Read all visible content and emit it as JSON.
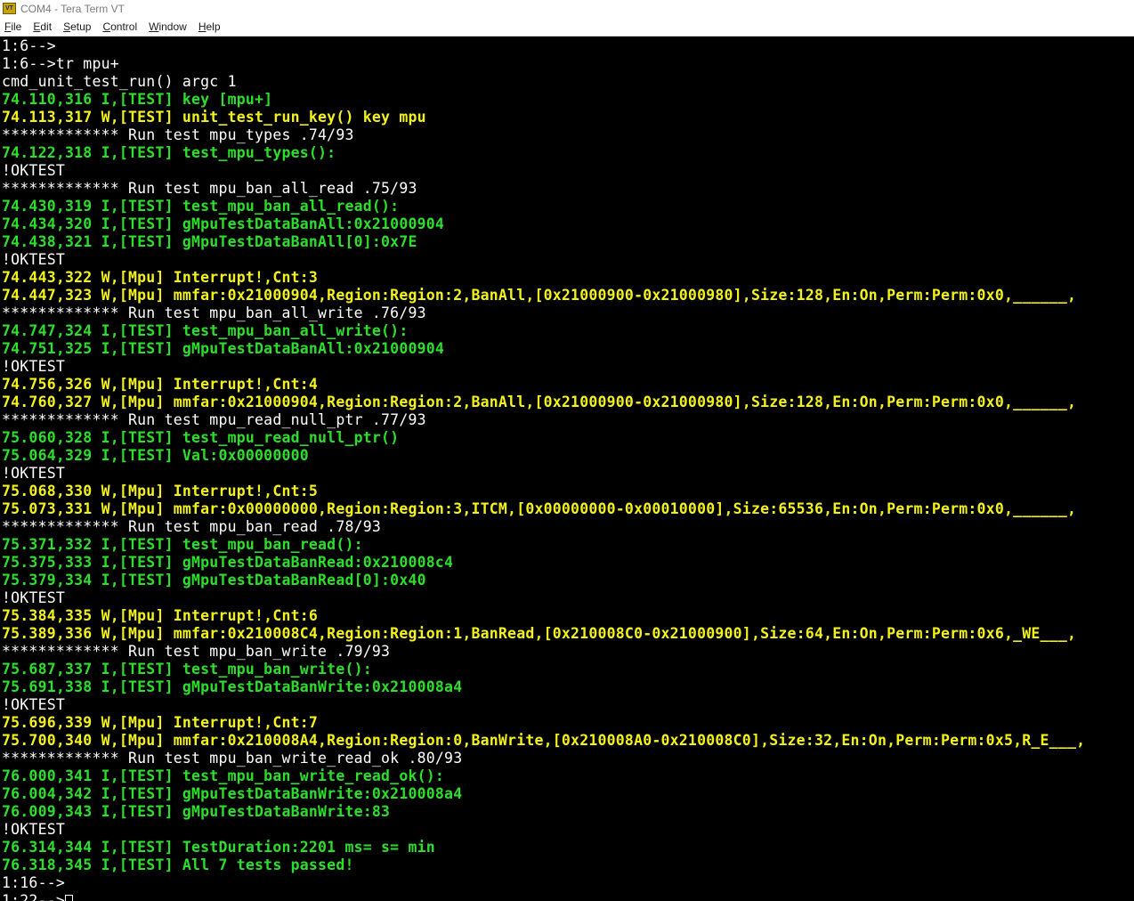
{
  "window": {
    "title": "COM4 - Tera Term VT",
    "icon": "teraterm-app-icon",
    "icon_text": "VT"
  },
  "menu": [
    {
      "underline": "F",
      "rest": "ile",
      "label": "File"
    },
    {
      "underline": "E",
      "rest": "dit",
      "label": "Edit"
    },
    {
      "underline": "S",
      "rest": "etup",
      "label": "Setup"
    },
    {
      "underline": "C",
      "rest": "ontrol",
      "label": "Control"
    },
    {
      "underline": "W",
      "rest": "indow",
      "label": "Window"
    },
    {
      "underline": "H",
      "rest": "elp",
      "label": "Help"
    }
  ],
  "colors": {
    "background": "#000000",
    "normal": "#ffffff",
    "info": "#2bdf2b",
    "warning": "#f2f218"
  },
  "terminal": {
    "lines": [
      {
        "c": "white",
        "t": "1:6-->"
      },
      {
        "c": "white",
        "t": "1:6-->tr mpu+"
      },
      {
        "c": "white",
        "t": "cmd_unit_test_run() argc 1"
      },
      {
        "c": "green",
        "t": "74.110,316 I,[TEST] key [mpu+]"
      },
      {
        "c": "yellow",
        "t": "74.113,317 W,[TEST] unit_test_run_key() key mpu"
      },
      {
        "c": "white",
        "t": "************* Run test mpu_types .74/93"
      },
      {
        "c": "green",
        "t": "74.122,318 I,[TEST] test_mpu_types():"
      },
      {
        "c": "white",
        "t": "!OKTEST"
      },
      {
        "c": "white",
        "t": "************* Run test mpu_ban_all_read .75/93"
      },
      {
        "c": "green",
        "t": "74.430,319 I,[TEST] test_mpu_ban_all_read():"
      },
      {
        "c": "green",
        "t": "74.434,320 I,[TEST] gMpuTestDataBanAll:0x21000904"
      },
      {
        "c": "green",
        "t": "74.438,321 I,[TEST] gMpuTestDataBanAll[0]:0x7E"
      },
      {
        "c": "white",
        "t": "!OKTEST"
      },
      {
        "c": "yellow",
        "t": "74.443,322 W,[Mpu] Interrupt!,Cnt:3"
      },
      {
        "c": "yellow",
        "t": "74.447,323 W,[Mpu] mmfar:0x21000904,Region:Region:2,BanAll,[0x21000900-0x21000980],Size:128,En:On,Perm:Perm:0x0,______,"
      },
      {
        "c": "white",
        "t": "************* Run test mpu_ban_all_write .76/93"
      },
      {
        "c": "green",
        "t": "74.747,324 I,[TEST] test_mpu_ban_all_write():"
      },
      {
        "c": "green",
        "t": "74.751,325 I,[TEST] gMpuTestDataBanAll:0x21000904"
      },
      {
        "c": "white",
        "t": "!OKTEST"
      },
      {
        "c": "yellow",
        "t": "74.756,326 W,[Mpu] Interrupt!,Cnt:4"
      },
      {
        "c": "yellow",
        "t": "74.760,327 W,[Mpu] mmfar:0x21000904,Region:Region:2,BanAll,[0x21000900-0x21000980],Size:128,En:On,Perm:Perm:0x0,______,"
      },
      {
        "c": "white",
        "t": "************* Run test mpu_read_null_ptr .77/93"
      },
      {
        "c": "green",
        "t": "75.060,328 I,[TEST] test_mpu_read_null_ptr()"
      },
      {
        "c": "green",
        "t": "75.064,329 I,[TEST] Val:0x00000000"
      },
      {
        "c": "white",
        "t": "!OKTEST"
      },
      {
        "c": "yellow",
        "t": "75.068,330 W,[Mpu] Interrupt!,Cnt:5"
      },
      {
        "c": "yellow",
        "t": "75.073,331 W,[Mpu] mmfar:0x00000000,Region:Region:3,ITCM,[0x00000000-0x00010000],Size:65536,En:On,Perm:Perm:0x0,______,"
      },
      {
        "c": "white",
        "t": "************* Run test mpu_ban_read .78/93"
      },
      {
        "c": "green",
        "t": "75.371,332 I,[TEST] test_mpu_ban_read():"
      },
      {
        "c": "green",
        "t": "75.375,333 I,[TEST] gMpuTestDataBanRead:0x210008c4"
      },
      {
        "c": "green",
        "t": "75.379,334 I,[TEST] gMpuTestDataBanRead[0]:0x40"
      },
      {
        "c": "white",
        "t": "!OKTEST"
      },
      {
        "c": "yellow",
        "t": "75.384,335 W,[Mpu] Interrupt!,Cnt:6"
      },
      {
        "c": "yellow",
        "t": "75.389,336 W,[Mpu] mmfar:0x210008C4,Region:Region:1,BanRead,[0x210008C0-0x21000900],Size:64,En:On,Perm:Perm:0x6,_WE___,"
      },
      {
        "c": "white",
        "t": "************* Run test mpu_ban_write .79/93"
      },
      {
        "c": "green",
        "t": "75.687,337 I,[TEST] test_mpu_ban_write():"
      },
      {
        "c": "green",
        "t": "75.691,338 I,[TEST] gMpuTestDataBanWrite:0x210008a4"
      },
      {
        "c": "white",
        "t": "!OKTEST"
      },
      {
        "c": "yellow",
        "t": "75.696,339 W,[Mpu] Interrupt!,Cnt:7"
      },
      {
        "c": "yellow",
        "t": "75.700,340 W,[Mpu] mmfar:0x210008A4,Region:Region:0,BanWrite,[0x210008A0-0x210008C0],Size:32,En:On,Perm:Perm:0x5,R_E___,"
      },
      {
        "c": "white",
        "t": "************* Run test mpu_ban_write_read_ok .80/93"
      },
      {
        "c": "green",
        "t": "76.000,341 I,[TEST] test_mpu_ban_write_read_ok():"
      },
      {
        "c": "green",
        "t": "76.004,342 I,[TEST] gMpuTestDataBanWrite:0x210008a4"
      },
      {
        "c": "green",
        "t": "76.009,343 I,[TEST] gMpuTestDataBanWrite:83"
      },
      {
        "c": "white",
        "t": "!OKTEST"
      },
      {
        "c": "green",
        "t": "76.314,344 I,[TEST] TestDuration:2201 ms= s= min"
      },
      {
        "c": "green",
        "t": "76.318,345 I,[TEST] All 7 tests passed!"
      },
      {
        "c": "white",
        "t": "1:16-->"
      },
      {
        "c": "white",
        "t": "1:22-->",
        "cursor": true
      }
    ]
  }
}
